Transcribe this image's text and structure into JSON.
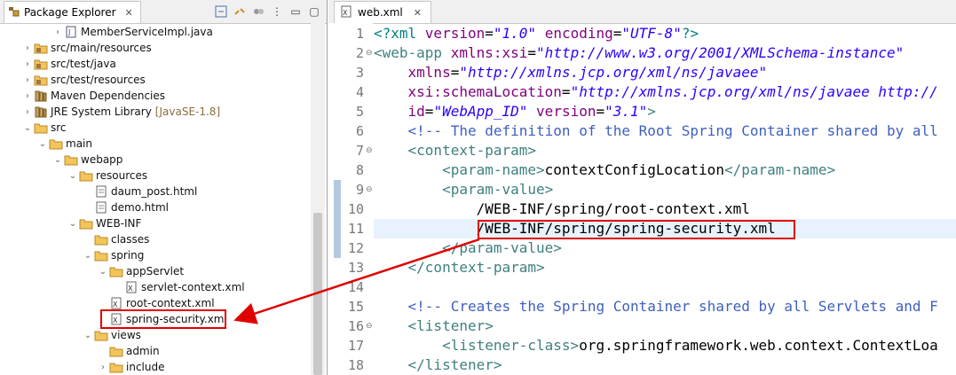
{
  "package_explorer": {
    "tab_label": "Package Explorer",
    "tree": [
      {
        "label": "MemberServiceImpl.java",
        "icon": "java-file-icon",
        "indent": 4,
        "twisty": "collapsed"
      },
      {
        "label": "src/main/resources",
        "icon": "source-folder-icon",
        "indent": 2,
        "twisty": "collapsed"
      },
      {
        "label": "src/test/java",
        "icon": "source-folder-icon",
        "indent": 2,
        "twisty": "collapsed"
      },
      {
        "label": "src/test/resources",
        "icon": "source-folder-icon",
        "indent": 2,
        "twisty": "collapsed"
      },
      {
        "label": "Maven Dependencies",
        "icon": "library-icon",
        "indent": 2,
        "twisty": "collapsed"
      },
      {
        "label": "JRE System Library",
        "decoration": "[JavaSE-1.8]",
        "icon": "library-icon",
        "indent": 2,
        "twisty": "collapsed"
      },
      {
        "label": "src",
        "icon": "folder-icon",
        "indent": 2,
        "twisty": "expanded"
      },
      {
        "label": "main",
        "icon": "folder-icon",
        "indent": 3,
        "twisty": "expanded"
      },
      {
        "label": "webapp",
        "icon": "folder-icon",
        "indent": 4,
        "twisty": "expanded"
      },
      {
        "label": "resources",
        "icon": "folder-icon",
        "indent": 5,
        "twisty": "expanded"
      },
      {
        "label": "daum_post.html",
        "icon": "html-file-icon",
        "indent": 6,
        "twisty": "none"
      },
      {
        "label": "demo.html",
        "icon": "html-file-icon",
        "indent": 6,
        "twisty": "none"
      },
      {
        "label": "WEB-INF",
        "icon": "folder-icon",
        "indent": 5,
        "twisty": "expanded"
      },
      {
        "label": "classes",
        "icon": "folder-icon",
        "indent": 6,
        "twisty": "none"
      },
      {
        "label": "spring",
        "icon": "folder-icon",
        "indent": 6,
        "twisty": "expanded"
      },
      {
        "label": "appServlet",
        "icon": "folder-icon",
        "indent": 7,
        "twisty": "expanded"
      },
      {
        "label": "servlet-context.xml",
        "icon": "xml-file-icon",
        "indent": 8,
        "twisty": "none"
      },
      {
        "label": "root-context.xml",
        "icon": "xml-file-icon",
        "indent": 7,
        "twisty": "none"
      },
      {
        "label": "spring-security.xml",
        "icon": "xml-file-icon",
        "indent": 7,
        "twisty": "none"
      },
      {
        "label": "views",
        "icon": "folder-icon",
        "indent": 6,
        "twisty": "expanded"
      },
      {
        "label": "admin",
        "icon": "folder-icon",
        "indent": 7,
        "twisty": "none"
      },
      {
        "label": "include",
        "icon": "folder-icon",
        "indent": 7,
        "twisty": "collapsed"
      }
    ]
  },
  "editor": {
    "tab_label": "web.xml",
    "lines": [
      {
        "n": "1",
        "fold": "",
        "segs": [
          [
            "pi",
            "<?xml "
          ],
          [
            "attr",
            "version"
          ],
          [
            "txt",
            "="
          ],
          [
            "str",
            "\"1.0\""
          ],
          [
            "txt",
            " "
          ],
          [
            "attr",
            "encoding"
          ],
          [
            "txt",
            "="
          ],
          [
            "str",
            "\"UTF-8\""
          ],
          [
            "pi",
            "?>"
          ]
        ]
      },
      {
        "n": "2",
        "fold": "⊖",
        "segs": [
          [
            "tag",
            "<web-app "
          ],
          [
            "attr",
            "xmlns:xsi"
          ],
          [
            "txt",
            "="
          ],
          [
            "str",
            "\"http://www.w3.org/2001/XMLSchema-instance\""
          ]
        ]
      },
      {
        "n": "3",
        "fold": "",
        "segs": [
          [
            "txt",
            "    "
          ],
          [
            "attr",
            "xmlns"
          ],
          [
            "txt",
            "="
          ],
          [
            "str",
            "\"http://xmlns.jcp.org/xml/ns/javaee\""
          ]
        ]
      },
      {
        "n": "4",
        "fold": "",
        "segs": [
          [
            "txt",
            "    "
          ],
          [
            "attr",
            "xsi:schemaLocation"
          ],
          [
            "txt",
            "="
          ],
          [
            "str",
            "\"http://xmlns.jcp.org/xml/ns/javaee http://"
          ]
        ]
      },
      {
        "n": "5",
        "fold": "",
        "segs": [
          [
            "txt",
            "    "
          ],
          [
            "attr",
            "id"
          ],
          [
            "txt",
            "="
          ],
          [
            "str",
            "\"WebApp_ID\""
          ],
          [
            "txt",
            " "
          ],
          [
            "attr",
            "version"
          ],
          [
            "txt",
            "="
          ],
          [
            "str",
            "\"3.1\""
          ],
          [
            "tag",
            ">"
          ]
        ]
      },
      {
        "n": "6",
        "fold": "",
        "segs": [
          [
            "txt",
            "    "
          ],
          [
            "cmt",
            "<!-- The definition of the Root Spring Container shared by all"
          ]
        ]
      },
      {
        "n": "7",
        "fold": "⊖",
        "segs": [
          [
            "txt",
            "    "
          ],
          [
            "tag",
            "<context-param>"
          ]
        ]
      },
      {
        "n": "8",
        "fold": "",
        "segs": [
          [
            "txt",
            "        "
          ],
          [
            "tag",
            "<param-name>"
          ],
          [
            "txt",
            "contextConfigLocation"
          ],
          [
            "tag",
            "</param-name>"
          ]
        ]
      },
      {
        "n": "9",
        "fold": "⊖",
        "segs": [
          [
            "txt",
            "        "
          ],
          [
            "tag",
            "<param-value>"
          ]
        ]
      },
      {
        "n": "10",
        "fold": "",
        "segs": [
          [
            "txt",
            "            /WEB-INF/spring/root-context.xml"
          ]
        ]
      },
      {
        "n": "11",
        "fold": "",
        "segs": [
          [
            "txt",
            "            /WEB-INF/spring/spring-security.xml"
          ]
        ]
      },
      {
        "n": "12",
        "fold": "",
        "segs": [
          [
            "txt",
            "        "
          ],
          [
            "tag",
            "</param-value>"
          ]
        ]
      },
      {
        "n": "13",
        "fold": "",
        "segs": [
          [
            "txt",
            "    "
          ],
          [
            "tag",
            "</context-param>"
          ]
        ]
      },
      {
        "n": "14",
        "fold": "",
        "segs": [
          [
            "txt",
            ""
          ]
        ]
      },
      {
        "n": "15",
        "fold": "",
        "segs": [
          [
            "txt",
            "    "
          ],
          [
            "cmt",
            "<!-- Creates the Spring Container shared by all Servlets and F"
          ]
        ]
      },
      {
        "n": "16",
        "fold": "⊖",
        "segs": [
          [
            "txt",
            "    "
          ],
          [
            "tag",
            "<listener>"
          ]
        ]
      },
      {
        "n": "17",
        "fold": "",
        "segs": [
          [
            "txt",
            "        "
          ],
          [
            "tag",
            "<listener-class>"
          ],
          [
            "txt",
            "org.springframework.web.context.ContextLoa"
          ]
        ]
      },
      {
        "n": "18",
        "fold": "",
        "segs": [
          [
            "txt",
            "    "
          ],
          [
            "tag",
            "</listener>"
          ]
        ]
      }
    ]
  }
}
